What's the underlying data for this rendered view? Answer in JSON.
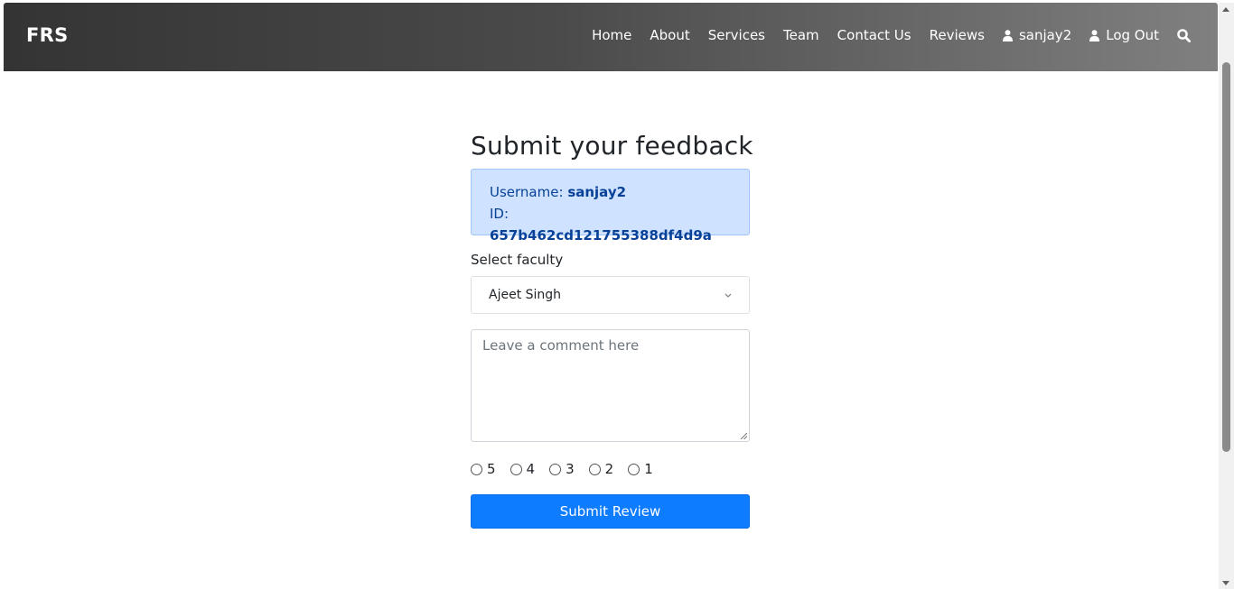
{
  "navbar": {
    "brand": "FRS",
    "links": [
      "Home",
      "About",
      "Services",
      "Team",
      "Contact Us",
      "Reviews"
    ],
    "user_label": "sanjay2",
    "logout_label": "Log Out",
    "icons": {
      "user": "user-icon",
      "search": "search-icon"
    }
  },
  "form": {
    "title": "Submit your feedback",
    "info": {
      "username_label": "Username:",
      "username_value": "sanjay2",
      "id_label": "ID:",
      "id_value": "657b462cd121755388df4d9a"
    },
    "faculty_label": "Select faculty",
    "faculty_selected": "Ajeet Singh",
    "comment_placeholder": "Leave a comment here",
    "ratings": [
      "5",
      "4",
      "3",
      "2",
      "1"
    ],
    "submit_label": "Submit Review"
  },
  "colors": {
    "primary": "#0d7cff",
    "info_bg": "#cfe2ff",
    "info_text": "#084298",
    "navbar_start": "#343434",
    "navbar_end": "#808080"
  }
}
